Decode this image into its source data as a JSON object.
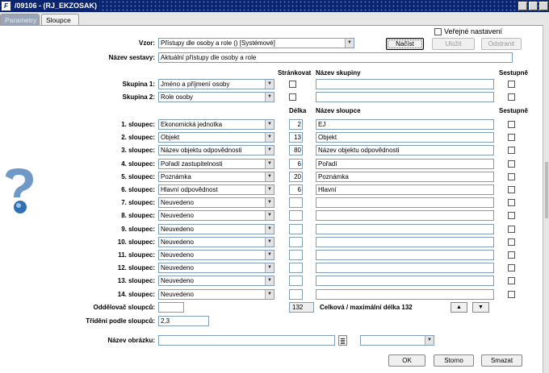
{
  "window": {
    "title": "/09106 - (RJ_EKZOSAK)",
    "app_icon": "F"
  },
  "tabs": [
    {
      "label": "Parametry"
    },
    {
      "label": "Sloupce"
    }
  ],
  "public_setting": {
    "label": "Veřejné nastavení"
  },
  "vzor": {
    "label": "Vzor:",
    "value": "Přístupy dle osoby a role   ()   [Systémové]"
  },
  "buttons": {
    "load": "Načíst",
    "save": "Uložit",
    "remove": "Odstranit",
    "ok": "OK",
    "cancel": "Storno",
    "delete": "Smazat"
  },
  "report_name": {
    "label": "Název sestavy:",
    "value": "Aktuální přístupy dle osoby a role"
  },
  "groups_header": {
    "paging": "Stránkovat",
    "group_name": "Název skupiny",
    "descending": "Sestupně"
  },
  "groups": [
    {
      "label": "Skupina 1:",
      "value": "Jméno a příjmení osoby",
      "name": ""
    },
    {
      "label": "Skupina 2:",
      "value": "Role osoby",
      "name": ""
    }
  ],
  "columns_header": {
    "length": "Délka",
    "column_name": "Název sloupce",
    "descending": "Sestupně"
  },
  "columns": [
    {
      "label": "1. sloupec:",
      "value": "Ekonomická jednotka",
      "length": "2",
      "name": "EJ"
    },
    {
      "label": "2. sloupec:",
      "value": "Objekt",
      "length": "13",
      "name": "Objekt"
    },
    {
      "label": "3. sloupec:",
      "value": "Název objektu odpovědnosti",
      "length": "80",
      "name": "Název objektu odpovědnosti"
    },
    {
      "label": "4. sloupec:",
      "value": "Pořadí zastupitelnosti",
      "length": "6",
      "name": "Pořadí"
    },
    {
      "label": "5. sloupec:",
      "value": "Poznámka",
      "length": "20",
      "name": "Poznámka"
    },
    {
      "label": "6. sloupec:",
      "value": "Hlavní odpovědnost",
      "length": "6",
      "name": "Hlavní"
    },
    {
      "label": "7. sloupec:",
      "value": "Neuvedeno",
      "length": "",
      "name": ""
    },
    {
      "label": "8. sloupec:",
      "value": "Neuvedeno",
      "length": "",
      "name": ""
    },
    {
      "label": "9. sloupec:",
      "value": "Neuvedeno",
      "length": "",
      "name": ""
    },
    {
      "label": "10. sloupec:",
      "value": "Neuvedeno",
      "length": "",
      "name": ""
    },
    {
      "label": "11. sloupec:",
      "value": "Neuvedeno",
      "length": "",
      "name": ""
    },
    {
      "label": "12. sloupec:",
      "value": "Neuvedeno",
      "length": "",
      "name": ""
    },
    {
      "label": "13. sloupec:",
      "value": "Neuvedeno",
      "length": "",
      "name": ""
    },
    {
      "label": "14. sloupec:",
      "value": "Neuvedeno",
      "length": "",
      "name": ""
    }
  ],
  "separator": {
    "label": "Oddělovač sloupců:",
    "value": ""
  },
  "total": {
    "value": "132",
    "label": "Celková / maximální délka 132"
  },
  "sorting": {
    "label": "Třídění podle sloupců:",
    "value": "2,3"
  },
  "image": {
    "label": "Název obrázku:",
    "value": "",
    "type_value": ""
  },
  "icons": {
    "help": "help-question-icon",
    "up": "arrow-up-icon",
    "down": "arrow-down-icon",
    "list": "list-icon"
  },
  "colors": {
    "titlebar": "#0a2470",
    "field_border": "#7f9db9"
  }
}
